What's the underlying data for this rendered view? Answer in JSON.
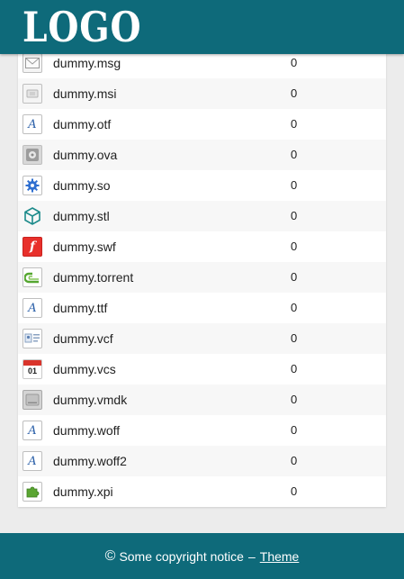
{
  "header": {
    "logo_text": "LOGO"
  },
  "files": [
    {
      "name": "dummy.msg",
      "size": "0",
      "icon": "envelope-icon"
    },
    {
      "name": "dummy.msi",
      "size": "0",
      "icon": "installer-icon"
    },
    {
      "name": "dummy.otf",
      "size": "0",
      "icon": "font-icon"
    },
    {
      "name": "dummy.ova",
      "size": "0",
      "icon": "disk-image-icon"
    },
    {
      "name": "dummy.so",
      "size": "0",
      "icon": "gear-icon"
    },
    {
      "name": "dummy.stl",
      "size": "0",
      "icon": "cube-icon"
    },
    {
      "name": "dummy.swf",
      "size": "0",
      "icon": "flash-icon"
    },
    {
      "name": "dummy.torrent",
      "size": "0",
      "icon": "torrent-icon"
    },
    {
      "name": "dummy.ttf",
      "size": "0",
      "icon": "font-icon"
    },
    {
      "name": "dummy.vcf",
      "size": "0",
      "icon": "contact-card-icon"
    },
    {
      "name": "dummy.vcs",
      "size": "0",
      "icon": "calendar-icon",
      "calendar_day": "01"
    },
    {
      "name": "dummy.vmdk",
      "size": "0",
      "icon": "hard-drive-icon"
    },
    {
      "name": "dummy.woff",
      "size": "0",
      "icon": "font-icon"
    },
    {
      "name": "dummy.woff2",
      "size": "0",
      "icon": "font-icon"
    },
    {
      "name": "dummy.xpi",
      "size": "0",
      "icon": "puzzle-icon"
    }
  ],
  "footer": {
    "copyright_symbol": "©",
    "notice": "Some copyright notice",
    "separator": "–",
    "theme_link": "Theme"
  },
  "colors": {
    "brand": "#0e6a7a",
    "row_alt": "#f7f7f7",
    "flash": "#e8302b",
    "torrent": "#55a630",
    "calendar": "#d9342b",
    "gear": "#2f6fd0",
    "cube": "#1b8a8a",
    "puzzle": "#5aa532"
  }
}
